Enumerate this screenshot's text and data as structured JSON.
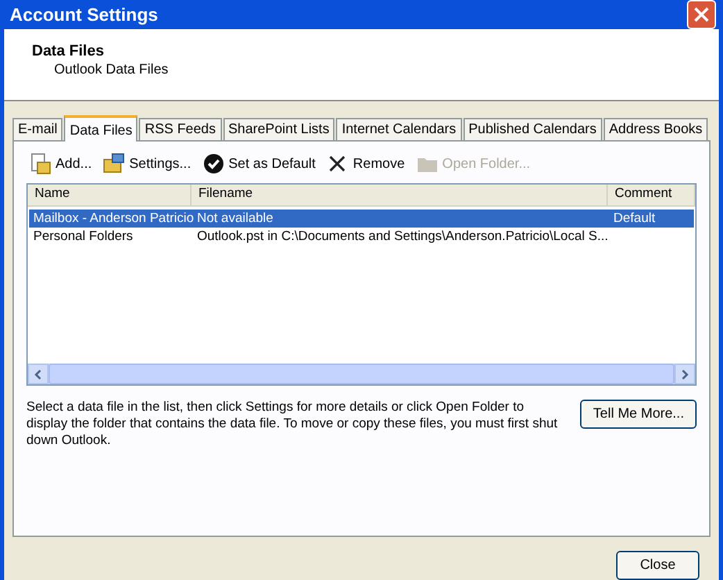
{
  "window": {
    "title": "Account Settings"
  },
  "header": {
    "title": "Data Files",
    "subtitle": "Outlook Data Files"
  },
  "tabs": [
    {
      "label": "E-mail",
      "selected": false
    },
    {
      "label": "Data Files",
      "selected": true
    },
    {
      "label": "RSS Feeds",
      "selected": false
    },
    {
      "label": "SharePoint Lists",
      "selected": false
    },
    {
      "label": "Internet Calendars",
      "selected": false
    },
    {
      "label": "Published Calendars",
      "selected": false
    },
    {
      "label": "Address Books",
      "selected": false
    }
  ],
  "toolbar": [
    {
      "kind": "add",
      "label": "Add...",
      "disabled": false
    },
    {
      "kind": "settings",
      "label": "Settings...",
      "disabled": false
    },
    {
      "kind": "default",
      "label": "Set as Default",
      "disabled": false
    },
    {
      "kind": "remove",
      "label": "Remove",
      "disabled": false
    },
    {
      "kind": "folder",
      "label": "Open Folder...",
      "disabled": true
    }
  ],
  "table": {
    "columns": [
      "Name",
      "Filename",
      "Comment"
    ],
    "rows": [
      {
        "cells": [
          "Mailbox - Anderson Patricio",
          "Not available",
          "Default"
        ],
        "selected": true
      },
      {
        "cells": [
          "Personal Folders",
          "Outlook.pst in C:\\Documents and Settings\\Anderson.Patricio\\Local S...",
          ""
        ],
        "selected": false
      }
    ]
  },
  "help_text": "Select a data file in the list, then click Settings for more details or click Open Folder to display the folder that contains the data file. To move or copy these files, you must first shut down Outlook.",
  "buttons": {
    "tell_more": "Tell Me More...",
    "close": "Close"
  }
}
